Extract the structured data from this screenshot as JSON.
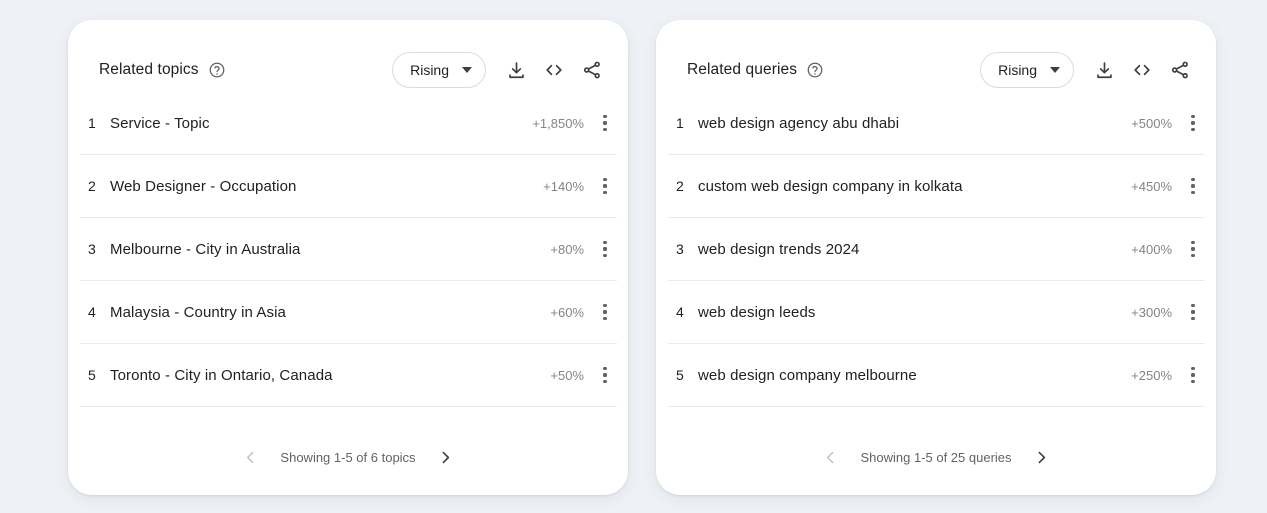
{
  "theme": {
    "page_background": "#eef1f6",
    "card_background": "#ffffff",
    "text_primary": "#202124",
    "text_secondary": "#5f6368",
    "value_color": "#80868b",
    "divider": "#e8eaed"
  },
  "panels": [
    {
      "id": "related-topics",
      "title": "Related topics",
      "help_icon": "help-circle-icon",
      "filter": {
        "label": "Rising",
        "caret_icon": "caret-down-icon",
        "options": [
          "Rising",
          "Top"
        ]
      },
      "actions": [
        {
          "name": "download-icon",
          "tooltip": "Download"
        },
        {
          "name": "embed-code-icon",
          "tooltip": "Embed"
        },
        {
          "name": "share-icon",
          "tooltip": "Share"
        }
      ],
      "rows": [
        {
          "rank": "1",
          "label": "Service - Topic",
          "value": "+1,850%",
          "menu_icon": "more-vert-icon"
        },
        {
          "rank": "2",
          "label": "Web Designer - Occupation",
          "value": "+140%",
          "menu_icon": "more-vert-icon"
        },
        {
          "rank": "3",
          "label": "Melbourne - City in Australia",
          "value": "+80%",
          "menu_icon": "more-vert-icon"
        },
        {
          "rank": "4",
          "label": "Malaysia - Country in Asia",
          "value": "+60%",
          "menu_icon": "more-vert-icon"
        },
        {
          "rank": "5",
          "label": "Toronto - City in Ontario, Canada",
          "value": "+50%",
          "menu_icon": "more-vert-icon"
        }
      ],
      "pagination": {
        "prev_icon": "chevron-left-icon",
        "next_icon": "chevron-right-icon",
        "text": "Showing 1-5 of 6 topics",
        "prev_enabled": false,
        "next_enabled": true
      }
    },
    {
      "id": "related-queries",
      "title": "Related queries",
      "help_icon": "help-circle-icon",
      "filter": {
        "label": "Rising",
        "caret_icon": "caret-down-icon",
        "options": [
          "Rising",
          "Top"
        ]
      },
      "actions": [
        {
          "name": "download-icon",
          "tooltip": "Download"
        },
        {
          "name": "embed-code-icon",
          "tooltip": "Embed"
        },
        {
          "name": "share-icon",
          "tooltip": "Share"
        }
      ],
      "rows": [
        {
          "rank": "1",
          "label": "web design agency abu dhabi",
          "value": "+500%",
          "menu_icon": "more-vert-icon"
        },
        {
          "rank": "2",
          "label": "custom web design company in kolkata",
          "value": "+450%",
          "menu_icon": "more-vert-icon"
        },
        {
          "rank": "3",
          "label": "web design trends 2024",
          "value": "+400%",
          "menu_icon": "more-vert-icon"
        },
        {
          "rank": "4",
          "label": "web design leeds",
          "value": "+300%",
          "menu_icon": "more-vert-icon"
        },
        {
          "rank": "5",
          "label": "web design company melbourne",
          "value": "+250%",
          "menu_icon": "more-vert-icon"
        }
      ],
      "pagination": {
        "prev_icon": "chevron-left-icon",
        "next_icon": "chevron-right-icon",
        "text": "Showing 1-5 of 25 queries",
        "prev_enabled": false,
        "next_enabled": true
      }
    }
  ]
}
